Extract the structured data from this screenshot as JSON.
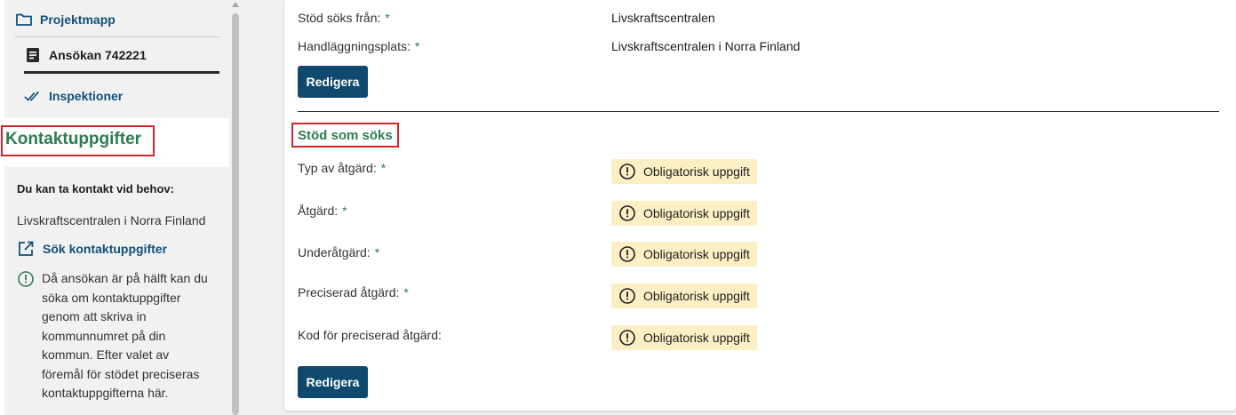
{
  "sidebar": {
    "nav": {
      "projektmapp": "Projektmapp",
      "ansokan": "Ansökan 742221",
      "inspektioner": "Inspektioner"
    },
    "kontakt_title": "Kontaktuppgifter",
    "info": {
      "heading": "Du kan ta kontakt vid behov:",
      "org": "Livskraftscentralen i Norra Finland",
      "link": "Sök kontaktuppgifter",
      "note_lines": [
        "Då ansökan är på hälft kan du",
        "söka om kontaktuppgifter",
        "genom att skriva in",
        "kommunnumret på din",
        "kommun. Efter valet av",
        "föremål för stödet preciseras",
        "kontaktuppgifterna här."
      ]
    }
  },
  "main": {
    "top_rows": [
      {
        "label": "Stöd söks från:",
        "required": "*",
        "value": "Livskraftscentralen"
      },
      {
        "label": "Handläggningsplats:",
        "required": "*",
        "value": "Livskraftscentralen i Norra Finland"
      }
    ],
    "edit_label": "Redigera",
    "section_title": "Stöd som söks",
    "fields": [
      {
        "label": "Typ av åtgärd:",
        "required": "*",
        "status": "Obligatorisk uppgift"
      },
      {
        "label": "Åtgärd:",
        "required": "*",
        "status": "Obligatorisk uppgift"
      },
      {
        "label": "Underåtgärd:",
        "required": "*",
        "status": "Obligatorisk uppgift"
      },
      {
        "label": "Preciserad åtgärd:",
        "required": "*",
        "status": "Obligatorisk uppgift"
      },
      {
        "label": "Kod för preciserad åtgärd:",
        "status": "Obligatorisk uppgift"
      }
    ]
  },
  "icons": {
    "folder": "folder-icon",
    "document": "document-icon",
    "checks": "double-check-icon",
    "external": "external-link-icon",
    "info": "exclamation-circle-icon"
  },
  "colors": {
    "link_blue": "#11507a",
    "button_blue": "#0f4a6e",
    "accent_green": "#2e7d4f",
    "highlight_red": "#d0262b",
    "warning_bg": "#fcefc4"
  }
}
